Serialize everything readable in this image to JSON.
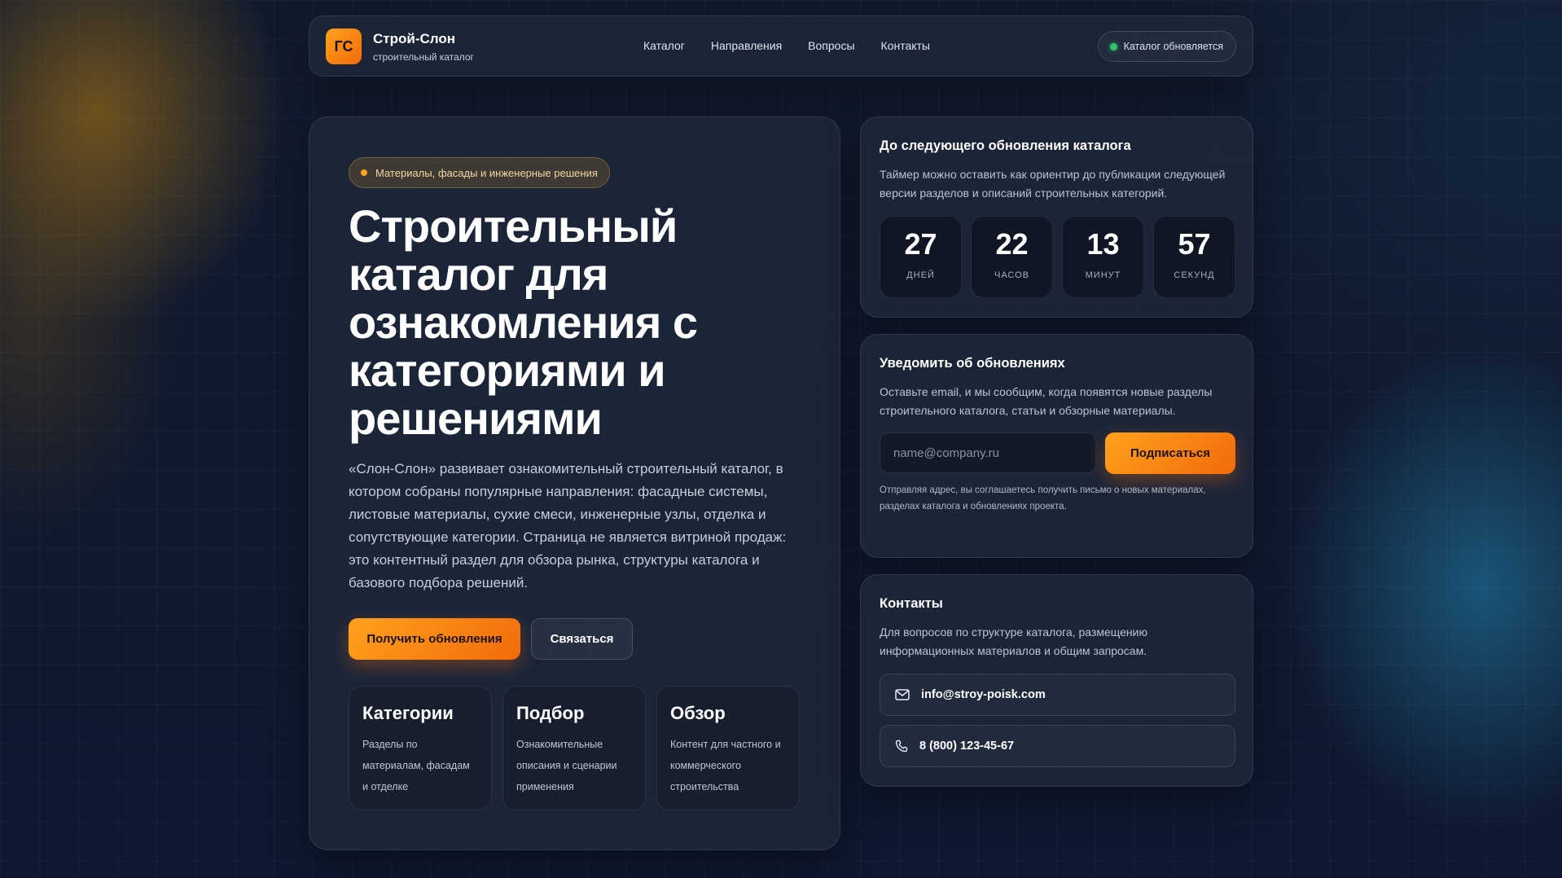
{
  "header": {
    "logo_text": "ГС",
    "brand_name": "Строй-Слон",
    "brand_sub": "строительный каталог",
    "nav": [
      "Каталог",
      "Направления",
      "Вопросы",
      "Контакты"
    ],
    "status": "Каталог обновляется",
    "status_color": "#2ec36b"
  },
  "hero": {
    "tag": "Материалы, фасады и инженерные решения",
    "title": "Строительный каталог для ознакомления с категориями и решениями",
    "text": "«Слон-Слон» развивает ознакомительный строительный каталог, в котором собраны популярные направления: фасадные системы, листовые материалы, сухие смеси, инженерные узлы, отделка и сопутствующие категории. Страница не является витриной продаж: это контентный раздел для обзора рынка, структуры каталога и базового подбора решений.",
    "primary_button": "Получить обновления",
    "secondary_button": "Связаться",
    "features": [
      {
        "title": "Категории",
        "text": "Разделы по материалам, фасадам и отделке"
      },
      {
        "title": "Подбор",
        "text": "Ознакомительные описания и сценарии применения"
      },
      {
        "title": "Обзор",
        "text": "Контент для частного и коммерческого строительства"
      }
    ]
  },
  "timer": {
    "title": "До следующего обновления каталога",
    "text": "Таймер можно оставить как ориентир до публикации следующей версии разделов и описаний строительных категорий.",
    "units": [
      {
        "value": "27",
        "label": "ДНЕЙ"
      },
      {
        "value": "22",
        "label": "ЧАСОВ"
      },
      {
        "value": "13",
        "label": "МИНУТ"
      },
      {
        "value": "57",
        "label": "СЕКУНД"
      }
    ]
  },
  "notify": {
    "title": "Уведомить об обновлениях",
    "text": "Оставьте email, и мы сообщим, когда появятся новые разделы строительного каталога, статьи и обзорные материалы.",
    "email_placeholder": "name@company.ru",
    "email_value": "",
    "button": "Подписаться",
    "note": "Отправляя адрес, вы соглашаетесь получить письмо о новых материалах, разделах каталога и обновлениях проекта."
  },
  "contacts": {
    "title": "Контакты",
    "text": "Для вопросов по структуре каталога, размещению информационных материалов и общим запросам.",
    "email": "info@stroy-poisk.com",
    "phone": "8 (800) 123-45-67",
    "email_icon": "mail-icon",
    "phone_icon": "phone-icon"
  },
  "colors": {
    "accent_start": "#ffa21d",
    "accent_end": "#f26a0a",
    "background": "#0e1729"
  }
}
